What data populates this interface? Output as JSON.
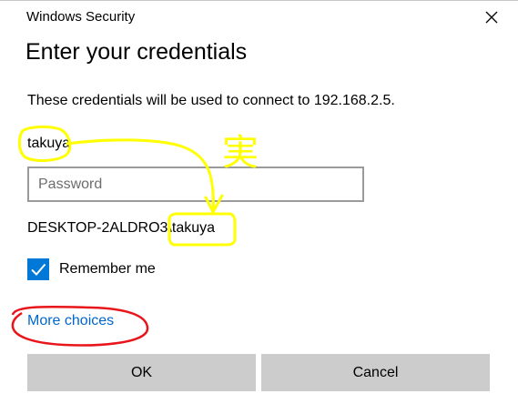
{
  "window": {
    "title": "Windows Security",
    "close_icon": "close-icon"
  },
  "dialog": {
    "heading": "Enter your credentials",
    "description": "These credentials will be used to connect to 192.168.2.5.",
    "username": "takuya",
    "password": {
      "value": "",
      "placeholder": "Password"
    },
    "account": "DESKTOP-2ALDRO3\\takuya",
    "remember_me": {
      "label": "Remember me",
      "checked": true
    },
    "more_choices": "More choices",
    "buttons": {
      "ok": "OK",
      "cancel": "Cancel"
    }
  },
  "annotations": {
    "yellow_color": "#ffff00",
    "red_color": "#e8151b",
    "handwritten_glyph": "実"
  },
  "colors": {
    "accent": "#0078d7",
    "link": "#0066cc",
    "button_bg": "#cccccc"
  }
}
